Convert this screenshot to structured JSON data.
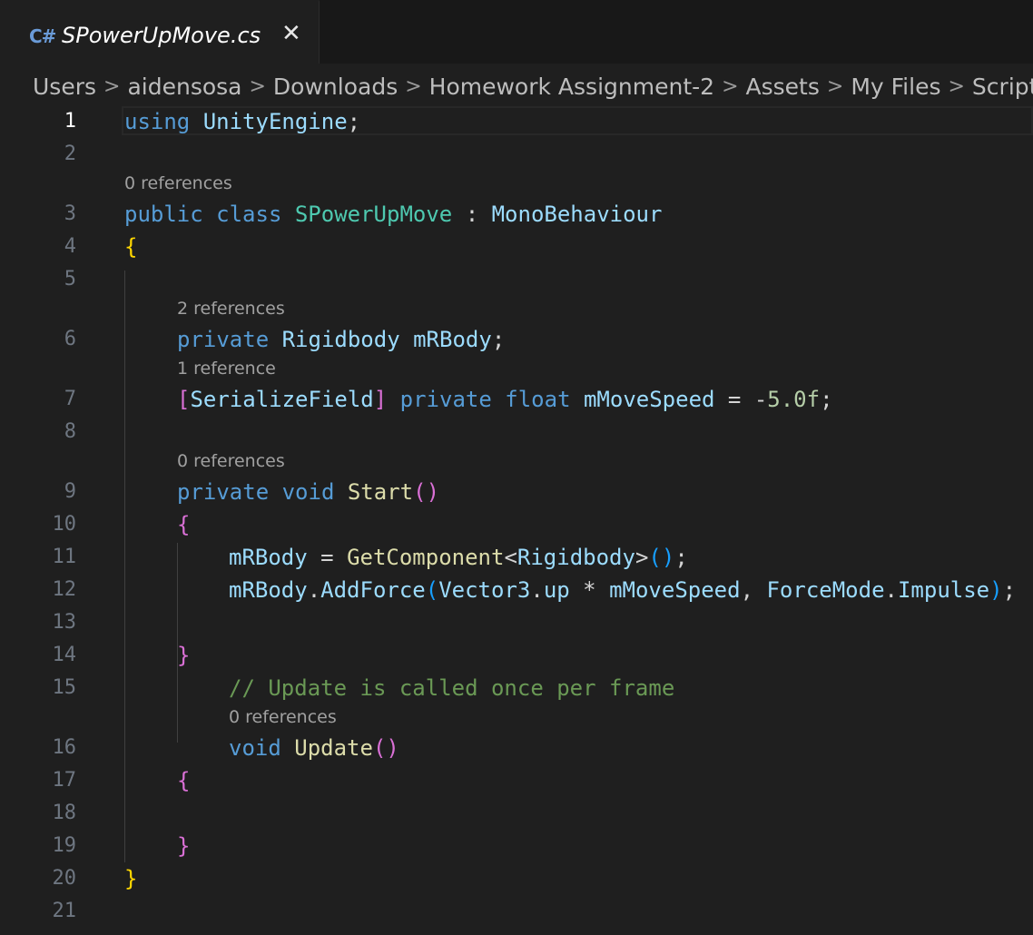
{
  "tab": {
    "icon": "C#",
    "title": "SPowerUpMove.cs",
    "close": "✕"
  },
  "breadcrumb": [
    "Users",
    "aidensosa",
    "Downloads",
    "Homework Assignment-2",
    "Assets",
    "My Files",
    "Scripts"
  ],
  "editor": {
    "active_line": 1,
    "lines": [
      {
        "num": "1",
        "lens": null
      },
      {
        "num": "2",
        "lens": null
      },
      {
        "num": "3",
        "lens": "0 references"
      },
      {
        "num": "4",
        "lens": null
      },
      {
        "num": "5",
        "lens": null
      },
      {
        "num": "6",
        "lens": "2 references"
      },
      {
        "num": "7",
        "lens": "1 reference"
      },
      {
        "num": "8",
        "lens": null
      },
      {
        "num": "9",
        "lens": "0 references"
      },
      {
        "num": "10",
        "lens": null
      },
      {
        "num": "11",
        "lens": null
      },
      {
        "num": "12",
        "lens": null
      },
      {
        "num": "13",
        "lens": null
      },
      {
        "num": "14",
        "lens": null
      },
      {
        "num": "15",
        "lens": null
      },
      {
        "num": "16",
        "lens": "0 references"
      },
      {
        "num": "17",
        "lens": null
      },
      {
        "num": "18",
        "lens": null
      },
      {
        "num": "19",
        "lens": null
      },
      {
        "num": "20",
        "lens": null
      },
      {
        "num": "21",
        "lens": null
      }
    ],
    "code": {
      "l1": [
        "using",
        " ",
        "UnityEngine",
        ";"
      ],
      "l3": [
        "public",
        " ",
        "class",
        " ",
        "SPowerUpMove",
        " : ",
        "MonoBehaviour"
      ],
      "l4": [
        "{"
      ],
      "l6": [
        "private",
        " ",
        "Rigidbody",
        " ",
        "mRBody",
        ";"
      ],
      "l7": [
        "[",
        "SerializeField",
        "]",
        " ",
        "private",
        " ",
        "float",
        " ",
        "mMoveSpeed",
        " = -",
        "5.0f",
        ";"
      ],
      "l9": [
        "private",
        " ",
        "void",
        " ",
        "Start",
        "(",
        ")"
      ],
      "l10": [
        "{"
      ],
      "l11": [
        "mRBody",
        " = ",
        "GetComponent",
        "<",
        "Rigidbody",
        ">",
        "(",
        ")",
        ";"
      ],
      "l12": [
        "mRBody",
        ".",
        "AddForce",
        "(",
        "Vector3",
        ".",
        "up",
        " * ",
        "mMoveSpeed",
        ", ",
        "ForceMode",
        ".",
        "Impulse",
        ")",
        ";"
      ],
      "l14": [
        "}"
      ],
      "l15": [
        "// Update is called once per frame"
      ],
      "l16": [
        "void",
        " ",
        "Update",
        "(",
        ")"
      ],
      "l17": [
        "{"
      ],
      "l19": [
        "}"
      ],
      "l20": [
        "}"
      ]
    }
  },
  "colors": {
    "background": "#1f1f1f",
    "keyword": "#569cd6",
    "type": "#4ec9b0",
    "variable": "#9cdcfe",
    "function": "#dcdcaa",
    "number": "#b5cea8",
    "comment": "#6a9955"
  }
}
